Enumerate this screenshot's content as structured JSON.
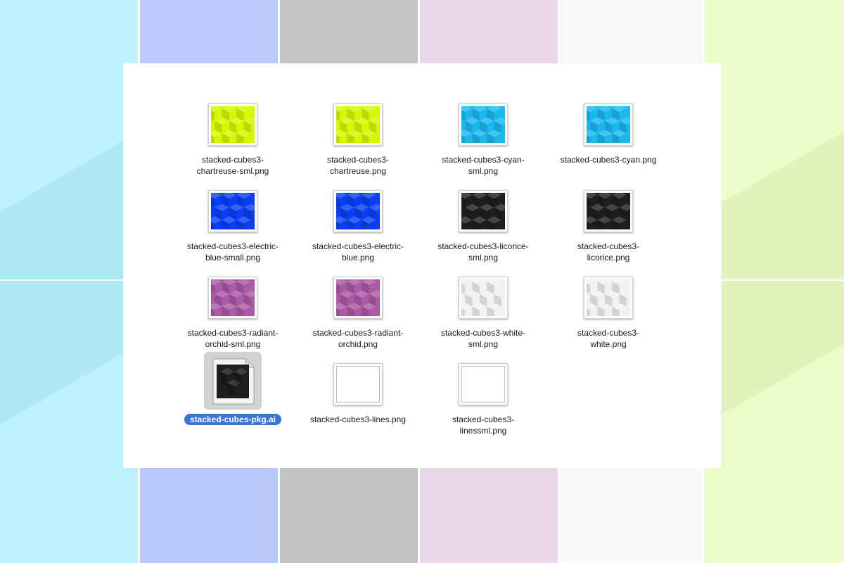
{
  "colors": {
    "bg_cyan": "#b6f0ff",
    "bg_blue": "#b3c4fb",
    "bg_gray": "#bdbdbd",
    "bg_orchid": "#e6d3e7",
    "bg_white": "#f7f7f7",
    "bg_chartreuse": "#eafcc4",
    "selection": "#3875d7"
  },
  "files": [
    {
      "label": "stacked-cubes3-\nchartreuse-sml.png",
      "color": "#d6f700",
      "icon": "chartreuse-thumbnail-icon"
    },
    {
      "label": "stacked-cubes3-\nchartreuse.png",
      "color": "#d6f700",
      "icon": "chartreuse-thumbnail-icon"
    },
    {
      "label": "stacked-cubes3-cyan-\nsml.png",
      "color": "#1ab8ef",
      "icon": "cyan-thumbnail-icon"
    },
    {
      "label": "stacked-cubes3-cyan.png",
      "color": "#1ab8ef",
      "icon": "cyan-thumbnail-icon"
    },
    {
      "label": "stacked-cubes3-electric-\nblue-small.png",
      "color": "#0a3ef5",
      "icon": "electric-blue-thumbnail-icon"
    },
    {
      "label": "stacked-cubes3-electric-\nblue.png",
      "color": "#0a3ef5",
      "icon": "electric-blue-thumbnail-icon"
    },
    {
      "label": "stacked-cubes3-licorice-\nsml.png",
      "color": "#1e1e1e",
      "icon": "licorice-thumbnail-icon"
    },
    {
      "label": "stacked-cubes3-\nlicorice.png",
      "color": "#1e1e1e",
      "icon": "licorice-thumbnail-icon"
    },
    {
      "label": "stacked-cubes3-radiant-\norchid-sml.png",
      "color": "#aa5aa6",
      "icon": "radiant-orchid-thumbnail-icon"
    },
    {
      "label": "stacked-cubes3-radiant-\norchid.png",
      "color": "#aa5aa6",
      "icon": "radiant-orchid-thumbnail-icon"
    },
    {
      "label": "stacked-cubes3-white-\nsml.png",
      "color": "#f1f1f1",
      "icon": "white-thumbnail-icon"
    },
    {
      "label": "stacked-cubes3-\nwhite.png",
      "color": "#f1f1f1",
      "icon": "white-thumbnail-icon"
    },
    {
      "label": "stacked-cubes-pkg.ai",
      "color": "#1e1e1e",
      "icon": "illustrator-document-icon",
      "selected": true
    },
    {
      "label": "stacked-cubes3-lines.png",
      "color": "#ffffff",
      "icon": "lines-thumbnail-icon"
    },
    {
      "label": "stacked-cubes3-\nlinessml.png",
      "color": "#ffffff",
      "icon": "lines-thumbnail-icon"
    }
  ]
}
